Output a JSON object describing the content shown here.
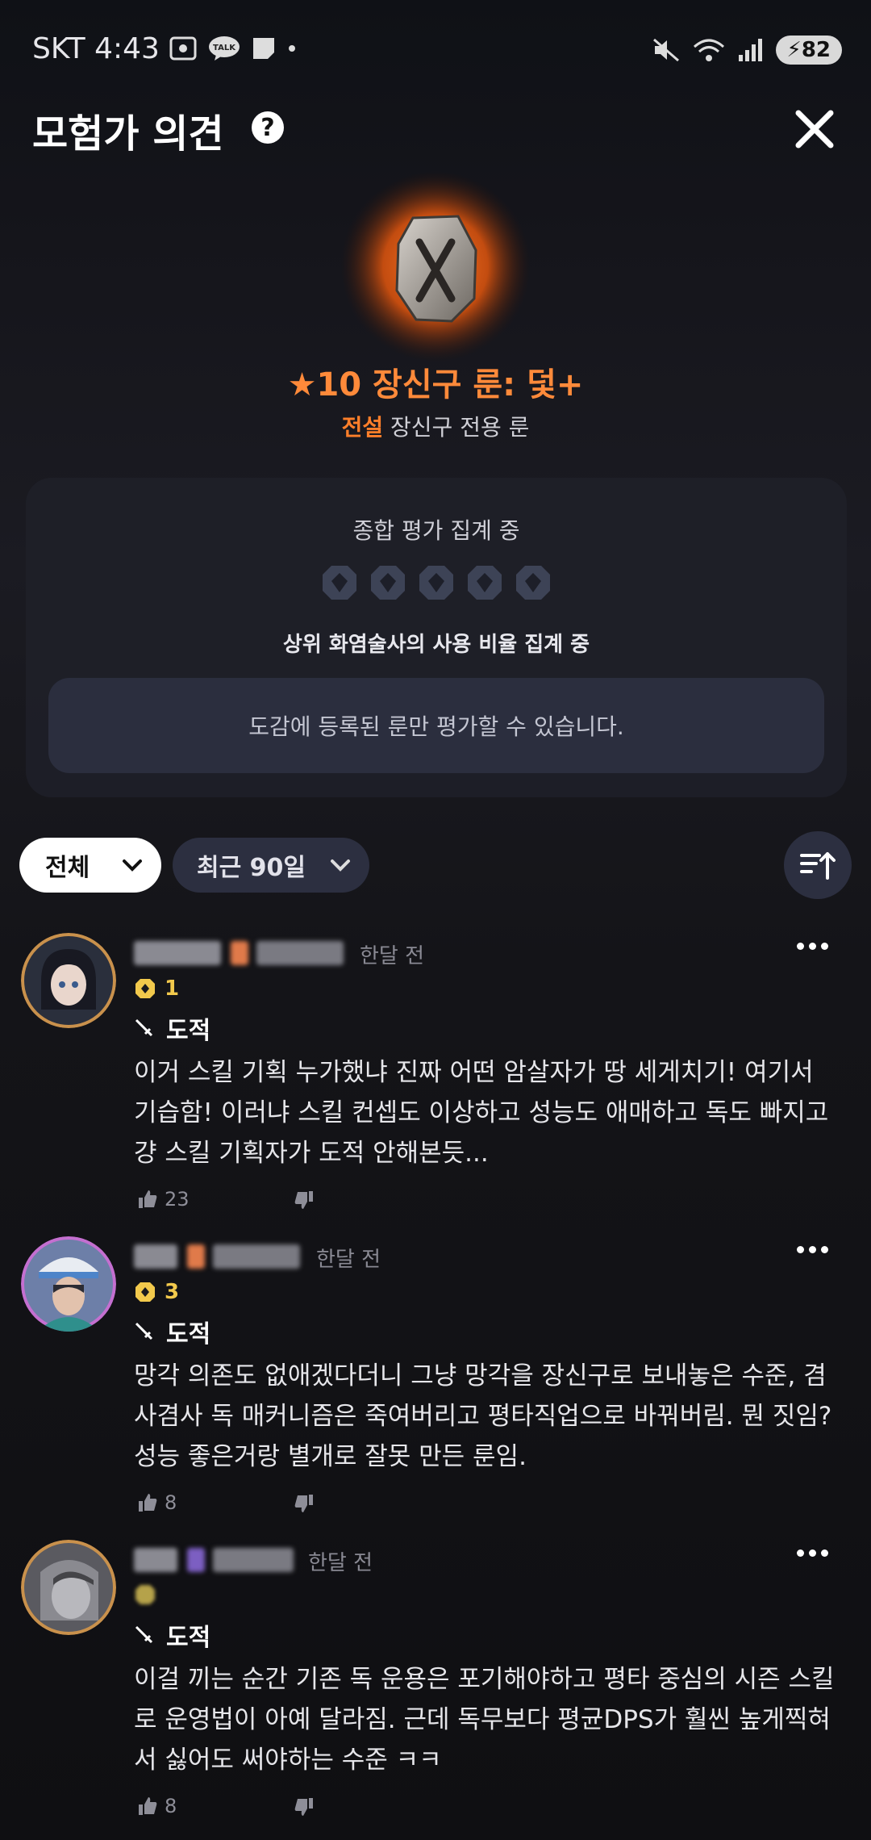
{
  "status_bar": {
    "carrier_time": "SKT 4:43",
    "battery": "82"
  },
  "header": {
    "title": "모험가 의견",
    "help": "?"
  },
  "item": {
    "name": "★10 장신구 룬: 덫+",
    "grade": "전설",
    "desc": "장신구 전용 룬"
  },
  "evaluation": {
    "title": "종합 평가 집계 중",
    "ratio": "상위 화염술사의 사용 비율 집계 중",
    "notice": "도감에 등록된 룬만 평가할 수 있습니다."
  },
  "filters": {
    "all": "전체",
    "period": "최근 90일"
  },
  "comments": [
    {
      "time": "한달 전",
      "level": "1",
      "class": "도적",
      "text": "이거 스킬 기획 누가했냐 진짜 어떤 암살자가 땅 세게치기! 여기서 기습함! 이러냐 스킬 컨셉도 이상하고 성능도 애매하고 독도 빠지고 걍 스킬 기획자가 도적 안해본듯...",
      "likes": "23"
    },
    {
      "time": "한달 전",
      "level": "3",
      "class": "도적",
      "text": "망각 의존도 없애겠다더니 그냥 망각을 장신구로 보내놓은 수준, 겸사겸사 독 매커니즘은 죽여버리고 평타직업으로 바꿔버림. 뭔 짓임? 성능 좋은거랑 별개로 잘못 만든 룬임.",
      "likes": "8"
    },
    {
      "time": "한달 전",
      "level": "",
      "class": "도적",
      "text": "이걸 끼는 순간 기존 독 운용은 포기해야하고 평타 중심의 시즌 스킬로 운영법이 아예 달라짐. 근데 독무보다 평균DPS가 훨씬 높게찍혀서 싫어도 써야하는 수준 ㅋㅋ",
      "likes": "8"
    }
  ],
  "colors": {
    "accent": "#ff8a3a",
    "grade": "#ff7f2a",
    "panel": "#1e1f28",
    "gold": "#f2c94c"
  }
}
